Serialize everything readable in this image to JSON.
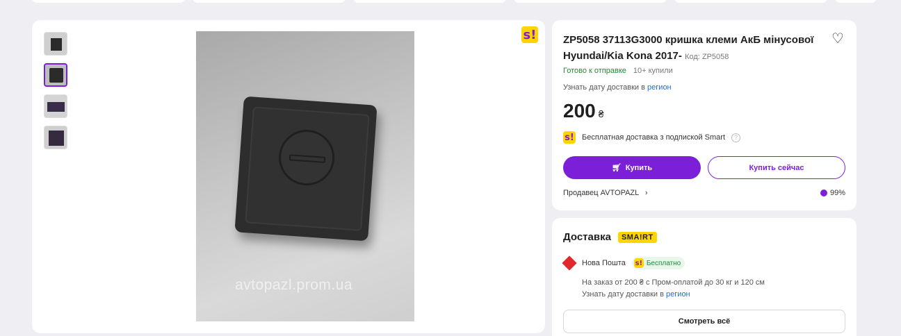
{
  "product": {
    "title": "ZP5058 37113G3000 кришка клеми АкБ мінусової Hyundai/Kia Kona 2017-",
    "code_label": "Код: ZP5058",
    "stock_status": "Готово к отправке",
    "bought_count": "10+ купили",
    "delivery_date_text": "Узнать дату доставки в",
    "delivery_date_link": "регион",
    "price": "200",
    "currency": "₴",
    "smart_free_text": "Бесплатная доставка з подпиской Smart",
    "buy_label": "Купить",
    "buy_now_label": "Купить сейчас",
    "seller_label": "Продавец AVTOPAZL",
    "rating": "99%"
  },
  "gallery": {
    "watermark": "avtopazl.prom.ua",
    "smart_badge": "s!",
    "thumb_count": 4,
    "active_thumb": 1
  },
  "delivery": {
    "title": "Доставка",
    "smart_logo": "SMA!RT",
    "carrier": "Нова Пошта",
    "free_label": "Бесплатно",
    "condition": "На заказ от 200 ₴ с Пром-оплатой до 30 кг и 120 см",
    "date_text": "Узнать дату доставки в",
    "date_link": "регион",
    "see_all_label": "Смотреть всё"
  },
  "colors": {
    "accent": "#7c1fd8",
    "smart_yellow": "#ffd400",
    "success": "#1a8a3b",
    "link": "#1a6fd6"
  }
}
